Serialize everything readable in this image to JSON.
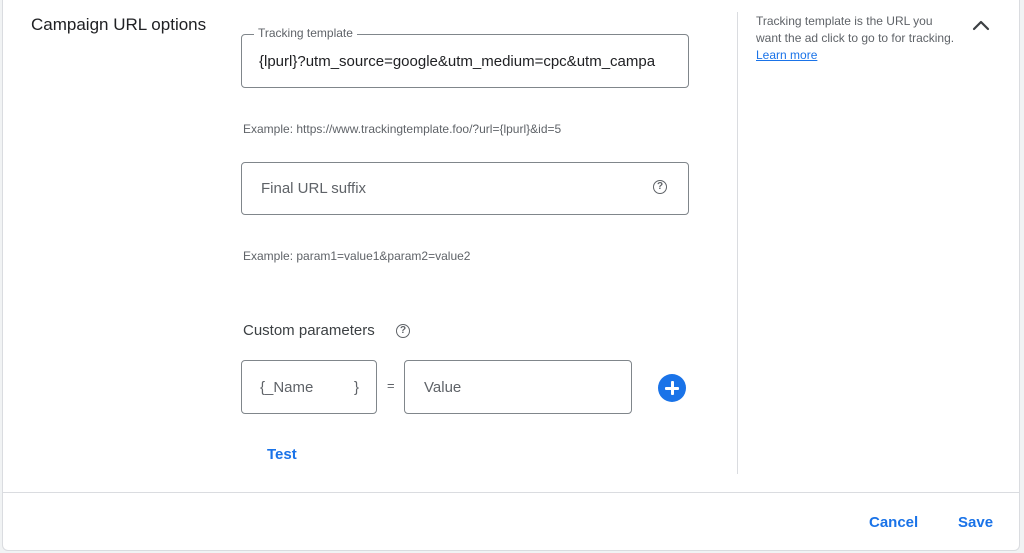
{
  "section": {
    "title": "Campaign URL options"
  },
  "tracking_template": {
    "label": "Tracking template",
    "value": "{lpurl}?utm_source=google&utm_medium=cpc&utm_campa",
    "example": "Example: https://www.trackingtemplate.foo/?url={lpurl}&id=5"
  },
  "final_url_suffix": {
    "placeholder": "Final URL suffix",
    "example": "Example: param1=value1&param2=value2",
    "help_icon": "help-circle-icon"
  },
  "custom_parameters": {
    "label": "Custom parameters",
    "help_icon": "help-circle-icon",
    "name_prefix": "{_Name",
    "name_suffix": "}",
    "equals": "=",
    "value_placeholder": "Value",
    "add_icon": "add-circle-icon",
    "test_label": "Test"
  },
  "side_help": {
    "text": "Tracking template is the URL you want the ad click to go to for tracking.",
    "link": "Learn more",
    "collapse_icon": "chevron-up-icon"
  },
  "footer": {
    "cancel_label": "Cancel",
    "save_label": "Save"
  },
  "colors": {
    "accent": "#1a73e8",
    "text": "#3c4043",
    "secondary_text": "#5f6368",
    "border": "#80868b",
    "divider": "#dadce0"
  }
}
